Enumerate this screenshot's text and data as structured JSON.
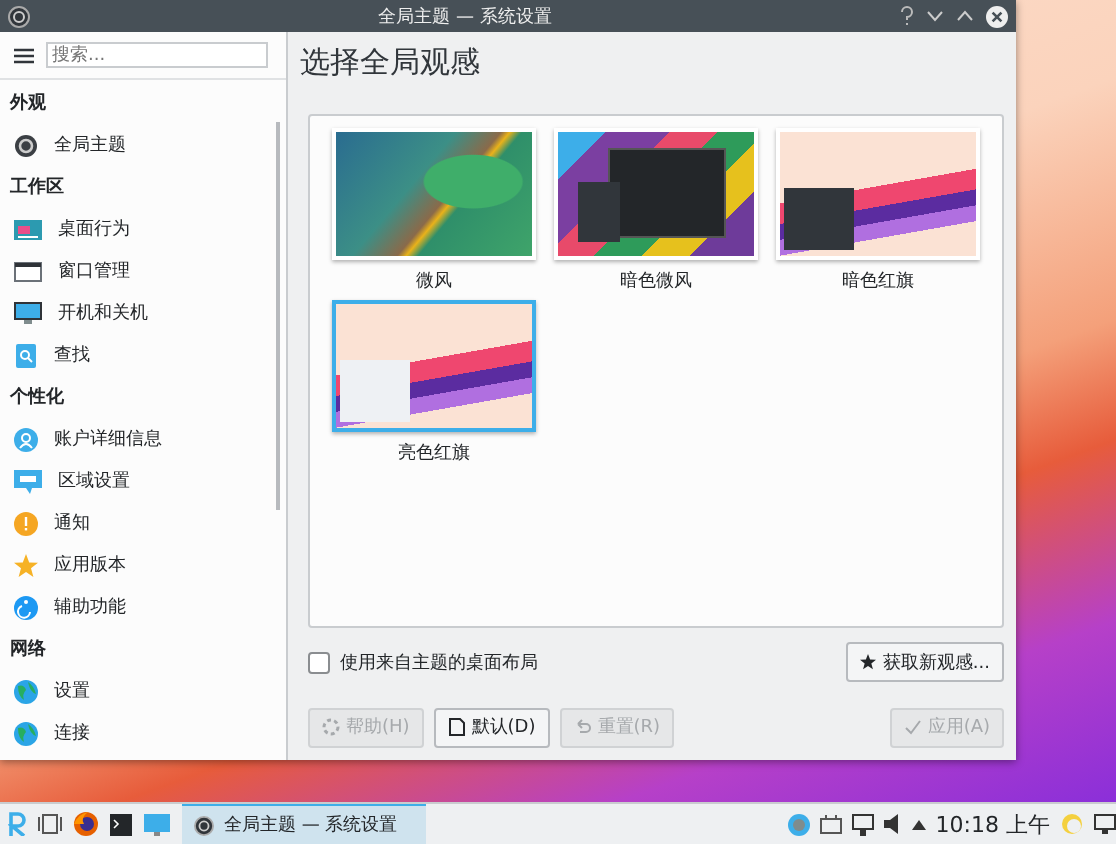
{
  "window": {
    "title": "全局主题 — 系统设置"
  },
  "sidebar": {
    "search": {
      "placeholder": "搜索..."
    },
    "groups": [
      {
        "heading": "外观",
        "items": [
          {
            "label": "全局主题",
            "kind": "theme",
            "selected": false
          }
        ]
      },
      {
        "heading": "工作区",
        "items": [
          {
            "label": "桌面行为",
            "kind": "desktop",
            "selected": false
          },
          {
            "label": "窗口管理",
            "kind": "window",
            "selected": false
          },
          {
            "label": "开机和关机",
            "kind": "monitor",
            "selected": false
          },
          {
            "label": "查找",
            "kind": "search",
            "selected": false
          }
        ]
      },
      {
        "heading": "个性化",
        "items": [
          {
            "label": "账户详细信息",
            "kind": "user",
            "selected": false
          },
          {
            "label": "区域设置",
            "kind": "locale",
            "selected": false
          },
          {
            "label": "通知",
            "kind": "bell",
            "selected": false
          },
          {
            "label": "应用版本",
            "kind": "star",
            "selected": false
          },
          {
            "label": "辅助功能",
            "kind": "access",
            "selected": false
          }
        ]
      },
      {
        "heading": "网络",
        "items": [
          {
            "label": "设置",
            "kind": "globe",
            "selected": false
          },
          {
            "label": "连接",
            "kind": "globe",
            "selected": false
          }
        ]
      }
    ]
  },
  "main": {
    "heading": "选择全局观感",
    "themes": [
      {
        "label": "微风",
        "kind": "breeze",
        "selected": false
      },
      {
        "label": "暗色微风",
        "kind": "breeze-dark",
        "selected": false
      },
      {
        "label": "暗色红旗",
        "kind": "redflag-dark",
        "selected": false
      },
      {
        "label": "亮色红旗",
        "kind": "redflag-light",
        "selected": true
      }
    ],
    "layout_checkbox": {
      "label": "使用来自主题的桌面布局",
      "checked": false
    },
    "get_new_button": {
      "label": "获取新观感..."
    },
    "buttons": [
      {
        "label": "帮助(H)",
        "kind": "help",
        "disabled": true
      },
      {
        "label": "默认(D)",
        "kind": "default",
        "disabled": false
      },
      {
        "label": "重置(R)",
        "kind": "reset",
        "disabled": true
      },
      {
        "label": "应用(A)",
        "kind": "apply",
        "disabled": true
      }
    ]
  },
  "taskbar": {
    "task": "全局主题 — 系统设置",
    "clock": "10:18 上午"
  }
}
